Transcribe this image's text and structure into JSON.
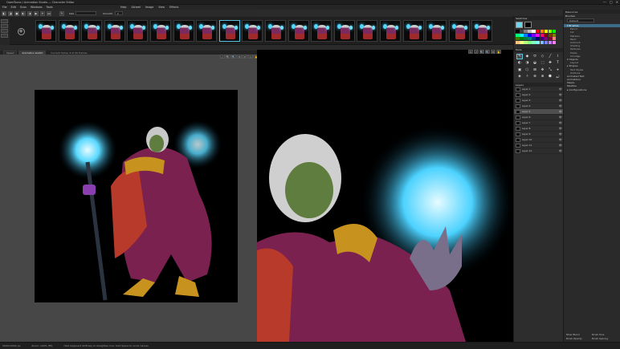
{
  "window": {
    "title": "OpenToonz / Animation Studio — Character Editor",
    "controls": [
      "—",
      "□",
      "✕"
    ]
  },
  "menubar": {
    "items": [
      "File",
      "Edit",
      "Scan",
      "Windows",
      "Tools",
      "Help",
      "Xsheet",
      "Image",
      "View",
      "Effects"
    ]
  },
  "toolbar": {
    "icons": [
      "◧",
      "◨",
      "▣",
      "◐",
      "◑",
      "▶",
      "⏵",
      "⏭"
    ],
    "brush_icon": "✎",
    "size_label": "Size",
    "size_value": "",
    "opacity_label": "Smooth:",
    "opacity_value": "0"
  },
  "frames": {
    "left_buttons": [
      "",
      "",
      "",
      ""
    ],
    "add_label": "+",
    "count": 20,
    "selected_index": 8
  },
  "tabs": [
    {
      "label": "Speed",
      "active": false
    },
    {
      "label": "Animation sketch",
      "active": true
    }
  ],
  "tab_info": "Current frame: 9 of 20 frames",
  "view_tools": [
    "⤢",
    "🔍",
    "🔍",
    "⟲",
    "⟳",
    "▭",
    "✋"
  ],
  "right_view_tools": [
    "1",
    "⤢",
    "🔍",
    "🔍",
    "⟲",
    "✋"
  ],
  "right_panel": {
    "swatches_title": "Swatches",
    "swatch_colors": [
      "#000000",
      "#3f3f3f",
      "#7f7f7f",
      "#bfbfbf",
      "#ffffff",
      "#ff0000",
      "#ff7f00",
      "#ffff00",
      "#7fff00",
      "#00ff00",
      "#00ff7f",
      "#00ffff",
      "#007fff",
      "#0000ff",
      "#7f00ff",
      "#ff00ff",
      "#ff007f",
      "#7f0000",
      "#7f3f00",
      "#7f7f00",
      "#3f7f00",
      "#007f00",
      "#007f3f",
      "#007f7f",
      "#003f7f",
      "#00007f",
      "#3f007f",
      "#7f007f",
      "#7f003f",
      "#ff7f7f",
      "#ffbf7f",
      "#ffff7f",
      "#bfff7f",
      "#7fff7f",
      "#7fffbf",
      "#7fffff",
      "#7fbfff",
      "#7f7fff",
      "#bf7fff",
      "#ff7fff"
    ],
    "primary_color": "#66d9ef",
    "secondary_color": "#000000",
    "tools_title": "Tools",
    "tools": [
      "✎",
      "◆",
      "⬭",
      "◇",
      "╱",
      "⌇",
      "◐",
      "◑",
      "◒",
      "⬚",
      "✚",
      "T",
      "▣",
      "⬡",
      "⊞",
      "✥",
      "⤡",
      "⌖",
      "◈",
      "✧",
      "⊕",
      "⊗",
      "⬢",
      "⤾"
    ],
    "selected_tool": 0,
    "layers_title": "Layers",
    "layers": [
      "Layer 1",
      "Layer 2",
      "Layer 3",
      "Layer 4",
      "Layer 5",
      "Layer 6",
      "Layer 7",
      "Layer 8",
      "Layer 9",
      "Layer 10",
      "Layer 11",
      "Layer 12"
    ],
    "selected_layer": 4,
    "layer_eye": "👁"
  },
  "far_panel": {
    "title": "Resources",
    "subtitle": "Brushes",
    "preset_label": "Default",
    "items": [
      {
        "label": "▾ Brushes",
        "sub": false,
        "sel": true
      },
      {
        "label": "Pencil",
        "sub": true
      },
      {
        "label": "Ink",
        "sub": true
      },
      {
        "label": "Markers",
        "sub": true
      },
      {
        "label": "Paint",
        "sub": true
      },
      {
        "label": "Airbrush",
        "sub": true
      },
      {
        "label": "Shading",
        "sub": true
      },
      {
        "label": "Textures",
        "sub": true
      },
      {
        "label": "Pixels",
        "sub": true
      },
      {
        "label": "Smudge",
        "sub": true
      },
      {
        "label": "▾ Objects",
        "sub": false
      },
      {
        "label": "Layout",
        "sub": true
      },
      {
        "label": "▸ Shapes",
        "sub": false
      },
      {
        "label": "Text Styles",
        "sub": true
      },
      {
        "label": "Outlines",
        "sub": true
      },
      {
        "label": "Animated Text",
        "sub": false
      },
      {
        "label": "Animations",
        "sub": false
      },
      {
        "label": "Masks",
        "sub": false
      },
      {
        "label": "Palettes",
        "sub": false
      },
      {
        "label": "▸ Configurations",
        "sub": false
      }
    ],
    "bottom_buttons": [
      "Mixer Blend",
      "Brush Tone",
      "Brush Opacity",
      "Brush Spacing"
    ]
  },
  "status": {
    "dims": "5000×5000 px",
    "zoom": "Zoom: 100% (Fit)",
    "hint": "Hold keyboard Shift key to straighten line; hold Space to scroll canvas"
  }
}
